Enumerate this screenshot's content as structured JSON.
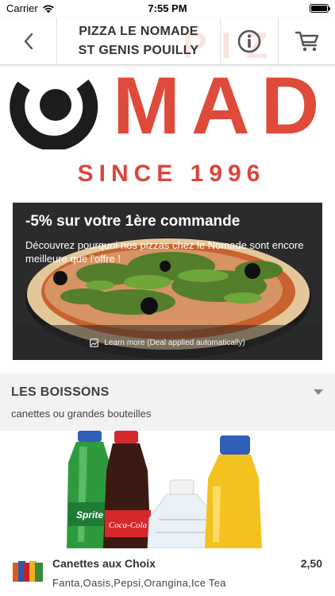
{
  "status_bar": {
    "carrier": "Carrier",
    "time": "7:55 PM"
  },
  "nav": {
    "title_line1": "PIZZA LE NOMADE",
    "title_line2": "ST GENIS POUILLY",
    "watermark": "PIZ"
  },
  "logo": {
    "word": "MAD",
    "since": "SINCE 1996"
  },
  "promo": {
    "title": "-5% sur votre 1ère commande",
    "description": "Découvrez pourquoi nos pizzas chez le Nomade sont encore meilleure que l'offre !",
    "learn_more": "Learn more (Deal applied automatically)"
  },
  "category": {
    "title": "LES BOISSONS",
    "subtitle": "canettes ou grandes bouteilles"
  },
  "bottle_labels": {
    "sprite": "Sprite",
    "coke": "Coca-Cola"
  },
  "item": {
    "name": "Canettes aux Choix",
    "price": "2,50",
    "description": "Fanta,Oasis,Pepsi,Orangina,Ice Tea"
  },
  "colors": {
    "brand_red": "#e04a3a",
    "section_bg": "#f2f2f2"
  },
  "icons": [
    "wifi-icon",
    "battery-icon",
    "back-chevron-icon",
    "info-icon",
    "cart-icon",
    "image-icon",
    "dropdown-arrow-icon"
  ]
}
